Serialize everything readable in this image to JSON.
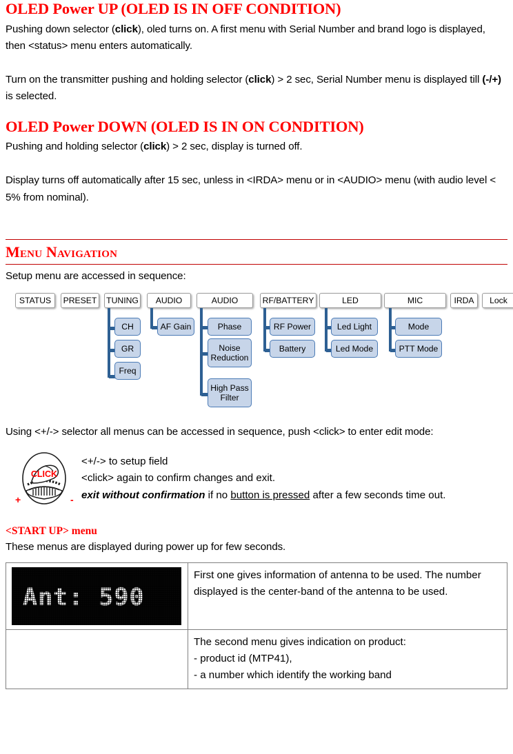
{
  "colors": {
    "heading_red": "#FF0000",
    "rule_red": "#C00000",
    "subbox_fill": "#C7D5E9",
    "subbox_border": "#4A7AB5",
    "connector_blue": "#2E6093",
    "table_border": "#808080",
    "oled_background": "#050505",
    "oled_text": "#F2F2F2"
  },
  "sections": {
    "power_up": {
      "heading": "OLED Power UP (OLED IS  IN OFF CONDITION)",
      "paragraph1": {
        "part1": "Pushing down selector (",
        "bold1": "click",
        "part2": "), oled turns on. A first menu with Serial Number and brand logo is displayed, then <status> menu enters automatically."
      },
      "paragraph2": {
        "part1": "Turn on the transmitter pushing and holding selector (",
        "bold1": "click",
        "part2": ") > 2 sec, Serial Number menu is displayed till ",
        "bold2": "(-/+)",
        "part3": " is selected."
      }
    },
    "power_down": {
      "heading": "OLED Power DOWN (OLED IS IN ON CONDITION)",
      "paragraph1": {
        "part1": "Pushing and holding selector (",
        "bold1": "click",
        "part2": ") > 2 sec, display is turned off."
      },
      "paragraph2": {
        "text": "Display turns off automatically after 15 sec, unless in <IRDA> menu or in <AUDIO> menu (with audio level < 5% from nominal)."
      }
    },
    "menu_navigation": {
      "heading": "Menu Navigation",
      "intro": "Setup menu are accessed in sequence:",
      "diagram": {
        "type": "tree",
        "columns": [
          {
            "label": "STATUS",
            "children": []
          },
          {
            "label": "PRESET",
            "children": []
          },
          {
            "label": "TUNING",
            "children": [
              "CH",
              "GR",
              "Freq"
            ]
          },
          {
            "label": "AUDIO",
            "children": [
              "AF Gain"
            ]
          },
          {
            "label": "AUDIO",
            "children": [
              "Phase",
              "Noise Reduction",
              "High Pass Filter"
            ]
          },
          {
            "label": "RF/BATTERY",
            "children": [
              "RF Power",
              "Battery"
            ]
          },
          {
            "label": "LED",
            "children": [
              "Led Light",
              "Led Mode"
            ]
          },
          {
            "label": "MIC",
            "children": [
              "Mode",
              "PTT Mode"
            ]
          },
          {
            "label": "IRDA",
            "children": []
          },
          {
            "label": "Lock",
            "children": []
          }
        ]
      },
      "outro": "Using <+/-> selector all menus can be accessed in sequence, push <click> to enter edit mode:",
      "knob": {
        "click_label": "CLICK",
        "plus_label": "+",
        "minus_label": "-"
      },
      "knob_lines": {
        "line1": "<+/-> to setup field",
        "line2": "<click> again to confirm changes and exit.",
        "line3_bold_italic": "exit without confirmation",
        "line3_mid": " if no ",
        "line3_underline": "button is pressed",
        "line3_end": " after a few seconds time out."
      }
    },
    "start_up": {
      "heading": "<START UP> menu",
      "intro": "These menus are displayed during power up for few seconds.",
      "table": {
        "rows": [
          {
            "oled_display": "Ant: 590",
            "description": "First one gives information of antenna to be used. The number displayed is the center-band of the antenna to be used."
          },
          {
            "oled_display": "",
            "description_lines": [
              "The second menu gives indication on product:",
              "- product id (MTP41),",
              "- a number which identify the working band"
            ]
          }
        ]
      }
    }
  }
}
